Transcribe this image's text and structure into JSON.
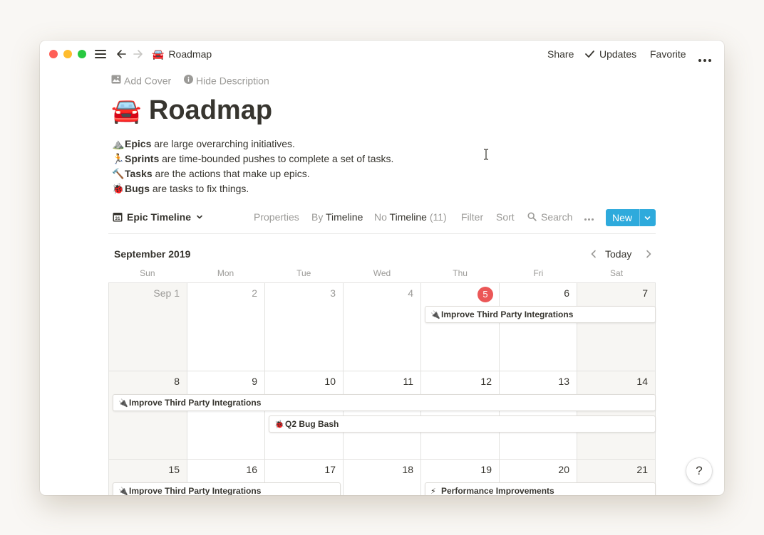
{
  "window": {
    "traffic_colors": [
      "#ff5f57",
      "#febc2e",
      "#28c840"
    ],
    "breadcrumb": {
      "icon": "🚘",
      "label": "Roadmap"
    },
    "actions": {
      "share": "Share",
      "updates": "Updates",
      "favorite": "Favorite"
    }
  },
  "page": {
    "add_cover": "Add Cover",
    "hide_description": "Hide Description",
    "title_icon": "🚘",
    "title": "Roadmap",
    "description": [
      {
        "icon": "⛰️",
        "term": "Epics",
        "text": " are large overarching initiatives."
      },
      {
        "icon": "🏃",
        "term": "Sprints",
        "text": " are time-bounded pushes to complete a set of tasks."
      },
      {
        "icon": "🔨",
        "term": "Tasks",
        "text": " are the actions that make up epics."
      },
      {
        "icon": "🐞",
        "term": "Bugs",
        "text": " are tasks to fix things."
      }
    ]
  },
  "view": {
    "name": "Epic Timeline",
    "properties": "Properties",
    "by_prefix": "By",
    "by_value": "Timeline",
    "no_prefix": "No",
    "no_value": "Timeline",
    "no_count": "(11)",
    "filter": "Filter",
    "sort": "Sort",
    "search": "Search",
    "new": "New",
    "accent": "#2eaadc"
  },
  "calendar": {
    "month": "September 2019",
    "today_label": "Today",
    "today_color": "#eb5757",
    "weekdays": [
      "Sun",
      "Mon",
      "Tue",
      "Wed",
      "Thu",
      "Fri",
      "Sat"
    ],
    "weeks": [
      [
        "Sep 1",
        "2",
        "3",
        "4",
        "5",
        "6",
        "7"
      ],
      [
        "8",
        "9",
        "10",
        "11",
        "12",
        "13",
        "14"
      ],
      [
        "15",
        "16",
        "17",
        "18",
        "19",
        "20",
        "21"
      ]
    ],
    "events": [
      {
        "icon": "🔌",
        "title": "Improve Third Party Integrations"
      },
      {
        "icon": "🔌",
        "title": "Improve Third Party Integrations"
      },
      {
        "icon": "🐞",
        "title": "Q2 Bug Bash"
      },
      {
        "icon": "🔌",
        "title": "Improve Third Party Integrations"
      },
      {
        "icon": "⚡",
        "title": "Performance Improvements"
      }
    ]
  },
  "help": "?"
}
